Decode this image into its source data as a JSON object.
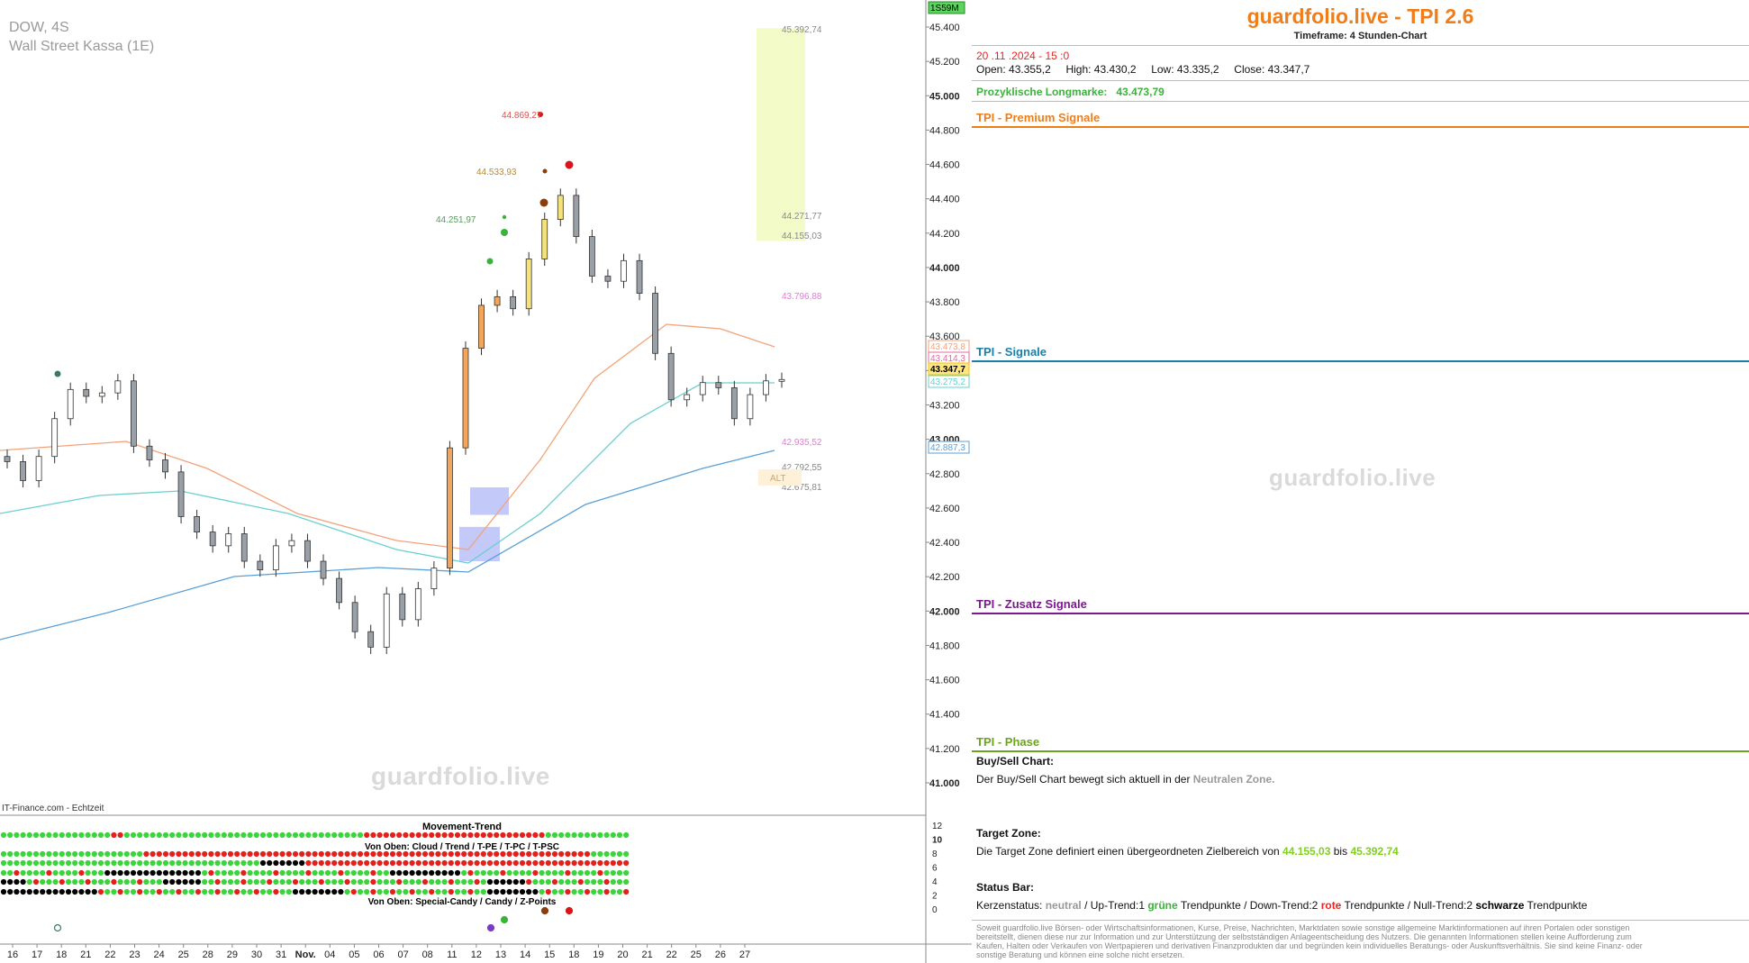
{
  "symbol": {
    "name": "DOW, 4S",
    "subtitle": "Wall Street Kassa (1E)"
  },
  "watermark": "guardfolio.live",
  "source": "IT-Finance.com - Echtzeit",
  "timeframe_badge": "1S59M",
  "panel_titles": {
    "movement": "Movement-Trend",
    "cloud": "Von Oben: Cloud / Trend / T-PE / T-PC / T-PSC",
    "candy": "Von Oben: Special-Candy / Candy / Z-Points"
  },
  "header": {
    "brand": "guardfolio.live - TPI 2.6",
    "timeframe": "Timeframe: 4 Stunden-Chart",
    "date": "20 .11 .2024 - 15 :0",
    "ohlc": {
      "open": "43.355,2",
      "high": "43.430,2",
      "low": "43.335,2",
      "close": "43.347,7"
    },
    "ohlc_labels": {
      "open": "Open:",
      "high": "High:",
      "low": "Low:",
      "close": "Close:"
    },
    "longmark_label": "Prozyklische Longmarke:",
    "longmark_value": "43.473,79"
  },
  "sections": {
    "premium": "TPI - Premium Signale",
    "signale": "TPI - Signale",
    "zusatz": "TPI - Zusatz Signale",
    "phase": "TPI - Phase"
  },
  "colors": {
    "premium": "#ef7d1a",
    "signale": "#1b7fa8",
    "zusatz": "#7a1a8a",
    "phase": "#6aa51b"
  },
  "buysell": {
    "title": "Buy/Sell Chart:",
    "text": "Der Buy/Sell Chart bewegt sich aktuell in der",
    "zone": "Neutralen Zone."
  },
  "target": {
    "title": "Target Zone:",
    "text": "Die Target Zone definiert einen übergeordneten Zielbereich von",
    "from": "44.155,03",
    "mid": "bis",
    "to": "45.392,74"
  },
  "status": {
    "title": "Status Bar:",
    "p1": "Kerzenstatus:",
    "neutral": "neutral",
    "p2": "/ Up-Trend:1",
    "green": "grüne",
    "p3": "Trendpunkte  / Down-Trend:2",
    "red": "rote",
    "p4": "Trendpunkte / Null-Trend:2",
    "black": "schwarze",
    "p5": "Trendpunkte"
  },
  "disclaimer": "Soweit guardfolio.live Börsen- oder Wirtschaftsinformationen, Kurse, Preise, Nachrichten, Marktdaten sowie sonstige allgemeine Marktinformationen auf ihren Portalen oder sonstigen bereitstellt, dienen diese nur zur Information und zur Unterstützung der selbstständigen Anlageentscheidung des Nutzers. Die genannten Informationen stellen keine Aufforderung zum Kaufen, Halten oder Verkaufen von Wertpapieren und derivativen Finanzprodukten dar und begründen kein individuelles Beratungs- oder Auskunftsverhältnis. Sie sind keine Finanz- oder sonstige Beratung und können eine solche nicht ersetzen.",
  "chart_data": {
    "type": "candlestick",
    "x_ticks": [
      "16",
      "17",
      "18",
      "21",
      "22",
      "23",
      "24",
      "25",
      "28",
      "29",
      "30",
      "31",
      "Nov.",
      "04",
      "05",
      "06",
      "07",
      "08",
      "11",
      "12",
      "13",
      "14",
      "15",
      "18",
      "19",
      "20",
      "21",
      "22",
      "25",
      "26",
      "27"
    ],
    "y_ticks": [
      "45.400",
      "45.200",
      "45.000",
      "44.800",
      "44.600",
      "44.400",
      "44.200",
      "44.000",
      "43.800",
      "43.600",
      "43.400",
      "43.200",
      "43.000",
      "42.800",
      "42.600",
      "42.400",
      "42.200",
      "42.000",
      "41.800",
      "41.600",
      "41.400",
      "41.200",
      "41.000"
    ],
    "ylim": [
      40900,
      45450
    ],
    "closes": [
      42870,
      42760,
      42900,
      43120,
      43290,
      43250,
      43270,
      43340,
      42960,
      42880,
      42810,
      42550,
      42460,
      42380,
      42450,
      42290,
      42240,
      42380,
      42410,
      42290,
      42190,
      42050,
      41880,
      41790,
      42100,
      41950,
      42130,
      42250,
      42950,
      43530,
      43780,
      43830,
      43760,
      44050,
      44280,
      44420,
      44180,
      43950,
      43920,
      44040,
      43850,
      43500,
      43230,
      43260,
      43330,
      43300,
      43120,
      43260,
      43340,
      43348
    ],
    "current_price": "43.347,7",
    "price_tags": [
      "43.473,8",
      "43.414,3",
      "43.347,7",
      "43.275,2",
      "42.887,3"
    ],
    "annotations": [
      "45.392,74",
      "44.869,27",
      "44.533,93",
      "44.251,97",
      "44.271,77",
      "44.155,03",
      "43.796,88",
      "42.935,52",
      "42.792,55",
      "42.675,81"
    ],
    "alt_label": "ALT",
    "osc_ticks": [
      "12",
      "10",
      "8",
      "6",
      "4",
      "2",
      "0"
    ],
    "target_zone": [
      44155.03,
      45392.74
    ]
  }
}
